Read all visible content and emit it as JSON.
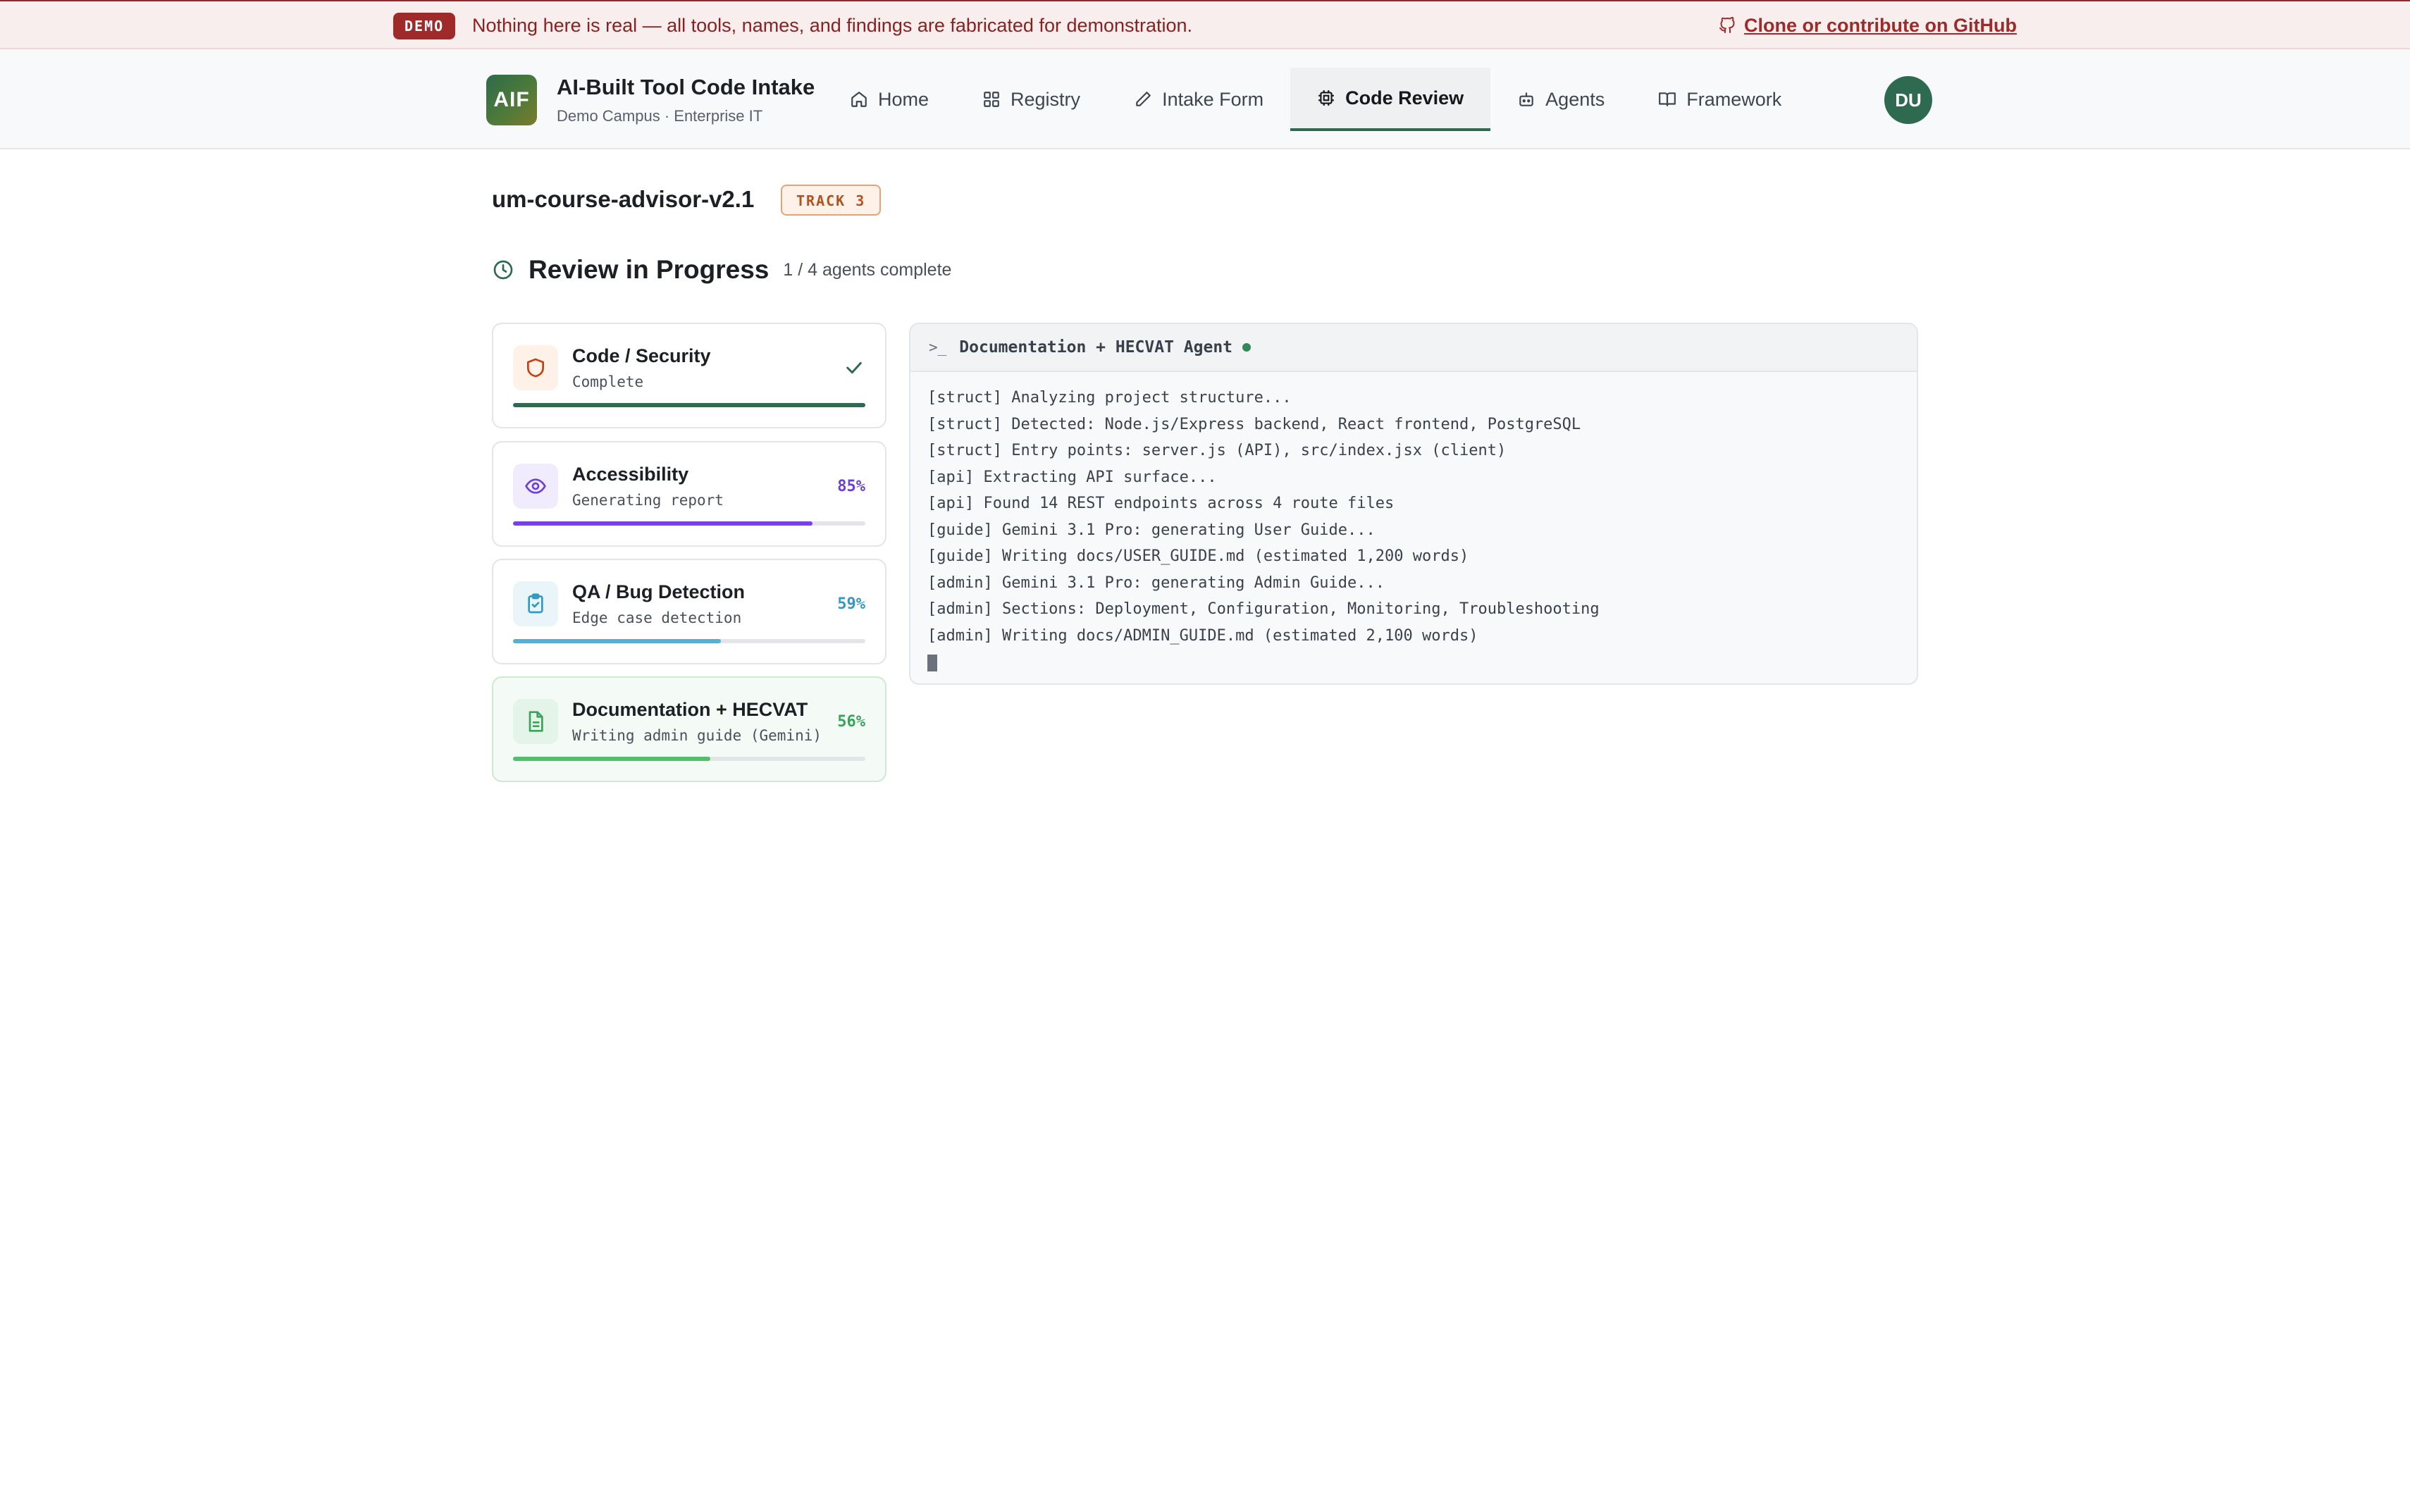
{
  "banner": {
    "badge": "DEMO",
    "message": "Nothing here is real — all tools, names, and findings are fabricated for demonstration.",
    "github_link": "Clone or contribute on GitHub"
  },
  "header": {
    "logo": "AIF",
    "title": "AI-Built Tool Code Intake",
    "subtitle": "Demo Campus · Enterprise IT",
    "nav": [
      {
        "label": "Home",
        "icon": "home-icon"
      },
      {
        "label": "Registry",
        "icon": "grid-icon"
      },
      {
        "label": "Intake Form",
        "icon": "pencil-icon"
      },
      {
        "label": "Code Review",
        "icon": "chip-icon",
        "active": true
      },
      {
        "label": "Agents",
        "icon": "bot-icon"
      },
      {
        "label": "Framework",
        "icon": "book-icon"
      }
    ],
    "avatar": "DU"
  },
  "tool": {
    "name": "um-course-advisor-v2.1",
    "track": "TRACK 3"
  },
  "review": {
    "title": "Review in Progress",
    "count": "1 / 4 agents complete"
  },
  "agents": [
    {
      "name": "Code / Security",
      "status": "Complete",
      "pct_label": "",
      "progress": 1.0,
      "color": "#2d6a4f",
      "icon": "shield-icon",
      "icon_color": "#c2410c",
      "icon_bg": "#fdf1e8"
    },
    {
      "name": "Accessibility",
      "status": "Generating report",
      "pct_label": "85%",
      "progress": 0.85,
      "color": "#7b3fe4",
      "icon": "eye-icon",
      "icon_color": "#6d3fd8",
      "icon_bg": "#f1ecfd"
    },
    {
      "name": "QA / Bug Detection",
      "status": "Edge case detection",
      "pct_label": "59%",
      "progress": 0.59,
      "color": "#5aaed1",
      "icon": "clipboard-check-icon",
      "icon_color": "#2f9bc4",
      "icon_bg": "#eaf5fa"
    },
    {
      "name": "Documentation + HECVAT",
      "status": "Writing admin guide (Gemini)",
      "pct_label": "56%",
      "progress": 0.56,
      "color": "#4fbf6a",
      "icon": "document-icon",
      "icon_color": "#3aa35a",
      "icon_bg": "#e4f4e8"
    }
  ],
  "terminal": {
    "title": "Documentation + HECVAT Agent",
    "lines": [
      "[struct] Analyzing project structure...",
      "[struct] Detected: Node.js/Express backend, React frontend, PostgreSQL",
      "[struct] Entry points: server.js (API), src/index.jsx (client)",
      "[api] Extracting API surface...",
      "[api] Found 14 REST endpoints across 4 route files",
      "[guide] Gemini 3.1 Pro: generating User Guide...",
      "[guide] Writing docs/USER_GUIDE.md (estimated 1,200 words)",
      "[admin] Gemini 3.1 Pro: generating Admin Guide...",
      "[admin] Sections: Deployment, Configuration, Monitoring, Troubleshooting",
      "[admin] Writing docs/ADMIN_GUIDE.md (estimated 2,100 words)"
    ]
  }
}
